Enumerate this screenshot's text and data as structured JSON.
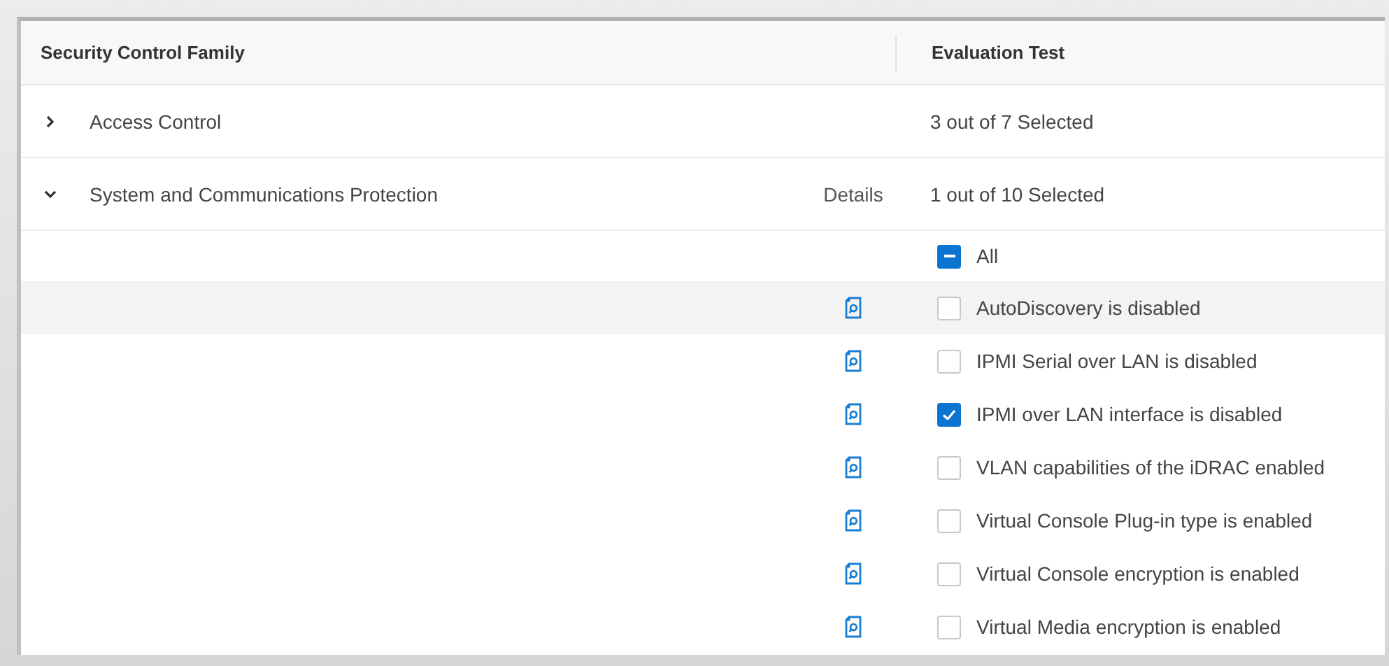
{
  "table": {
    "columns": [
      "Security Control Family",
      "Evaluation Test"
    ],
    "families": [
      {
        "name": "Access Control",
        "expanded": false,
        "summary": "3 out of 7 Selected"
      },
      {
        "name": "System and Communications Protection",
        "expanded": true,
        "details": "Details",
        "summary": "1 out of 10 Selected",
        "select_all": {
          "label": "All",
          "indeterminate": true
        },
        "tests": [
          {
            "label": "AutoDiscovery is disabled",
            "checked": false,
            "hovered": true
          },
          {
            "label": "IPMI Serial over LAN is disabled",
            "checked": false,
            "hovered": false
          },
          {
            "label": "IPMI over LAN interface is disabled",
            "checked": true,
            "hovered": false
          },
          {
            "label": "VLAN capabilities of the iDRAC enabled",
            "checked": false,
            "hovered": false
          },
          {
            "label": "Virtual Console Plug-in type is enabled",
            "checked": false,
            "hovered": false
          },
          {
            "label": "Virtual Console encryption is enabled",
            "checked": false,
            "hovered": false
          },
          {
            "label": "Virtual Media encryption is enabled",
            "checked": false,
            "hovered": false
          }
        ]
      }
    ]
  }
}
